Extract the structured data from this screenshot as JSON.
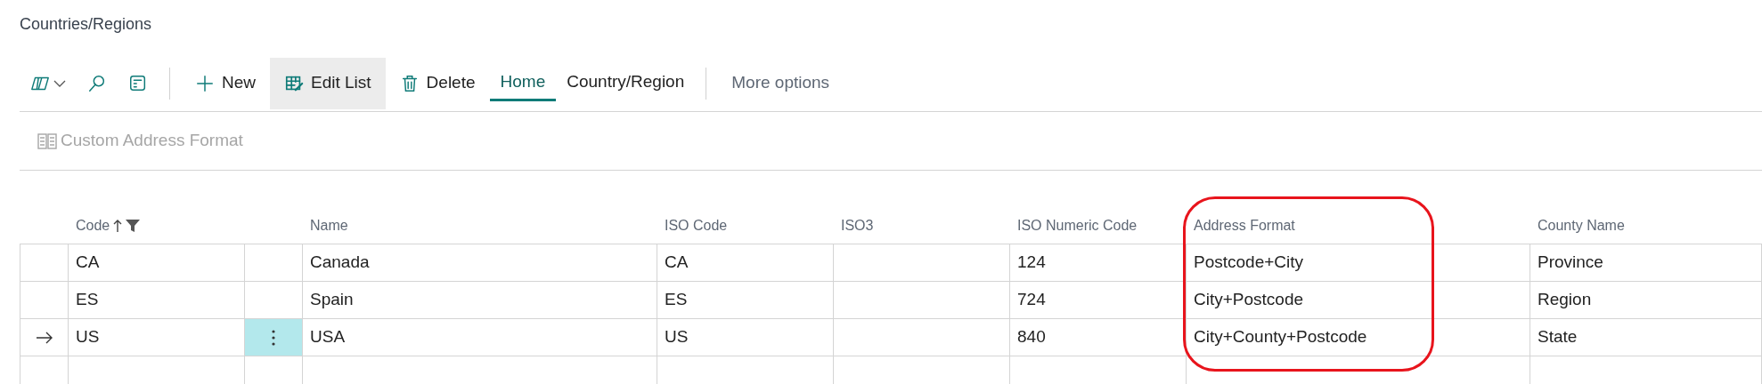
{
  "page": {
    "title": "Countries/Regions"
  },
  "actions": [
    {
      "label": "New",
      "selected": false
    },
    {
      "label": "Edit List",
      "selected": true
    },
    {
      "label": "Delete",
      "selected": false
    }
  ],
  "tabs": [
    {
      "label": "Home",
      "selected": true
    },
    {
      "label": "Country/Region",
      "selected": false
    }
  ],
  "more": {
    "label": "More options"
  },
  "sub_actions": [
    {
      "label": "Custom Address Format",
      "disabled": true
    }
  ],
  "table": {
    "columns": [
      {
        "label": "Code",
        "sorted": true,
        "filtered": true
      },
      {
        "label": "Name"
      },
      {
        "label": "ISO Code"
      },
      {
        "label": "ISO3"
      },
      {
        "label": "ISO Numeric Code"
      },
      {
        "label": "Address Format",
        "highlighted": true
      },
      {
        "label": "County Name"
      }
    ],
    "rows": [
      {
        "selected": false,
        "cells": [
          "CA",
          "Canada",
          "CA",
          "",
          "124",
          "Postcode+City",
          "Province"
        ]
      },
      {
        "selected": false,
        "cells": [
          "ES",
          "Spain",
          "ES",
          "",
          "724",
          "City+Postcode",
          "Region"
        ]
      },
      {
        "selected": true,
        "cells": [
          "US",
          "USA",
          "US",
          "",
          "840",
          "City+County+Postcode",
          "State"
        ]
      }
    ]
  }
}
